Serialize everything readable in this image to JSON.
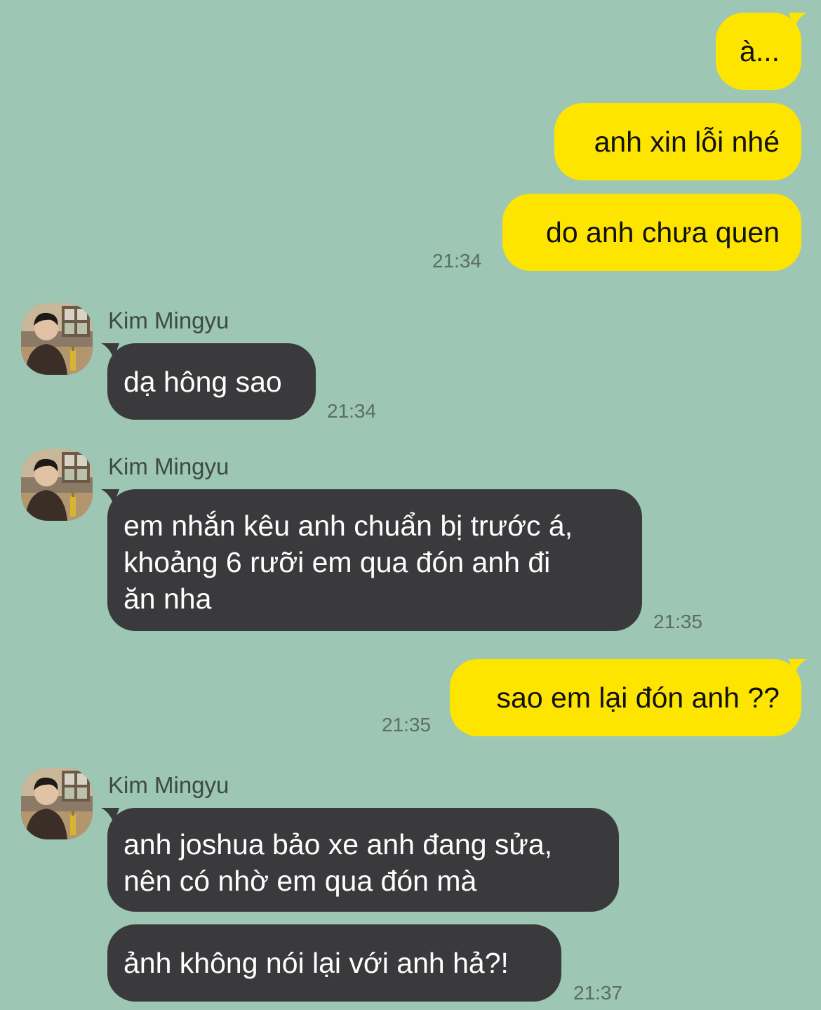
{
  "colors": {
    "background": "#9dc6b4",
    "my_bubble": "#fee500",
    "their_bubble": "#3a3a3c",
    "my_text": "#111111",
    "their_text": "#ffffff",
    "time_text": "#5c6d66"
  },
  "contact": {
    "name": "Kim Mingyu",
    "avatar_icon": "profile-photo-avatar"
  },
  "messages": [
    {
      "from": "me",
      "text": "à..."
    },
    {
      "from": "me",
      "text": "anh xin lỗi nhé"
    },
    {
      "from": "me",
      "text": "do anh chưa quen",
      "time": "21:34"
    },
    {
      "from": "them",
      "sender": "Kim Mingyu",
      "text": "dạ hông sao",
      "time": "21:34"
    },
    {
      "from": "them",
      "sender": "Kim Mingyu",
      "lines": [
        "em nhắn kêu anh chuẩn bị trước á,",
        "khoảng 6 rưỡi em qua đón anh đi",
        "ăn nha"
      ],
      "time": "21:35"
    },
    {
      "from": "me",
      "text": "sao em lại đón anh ??",
      "time": "21:35"
    },
    {
      "from": "them",
      "sender": "Kim Mingyu",
      "lines": [
        "anh joshua bảo xe anh đang sửa,",
        "nên có nhờ em qua đón mà"
      ]
    },
    {
      "from": "them",
      "text": "ảnh không nói lại với anh hả?!",
      "time": "21:37"
    }
  ]
}
